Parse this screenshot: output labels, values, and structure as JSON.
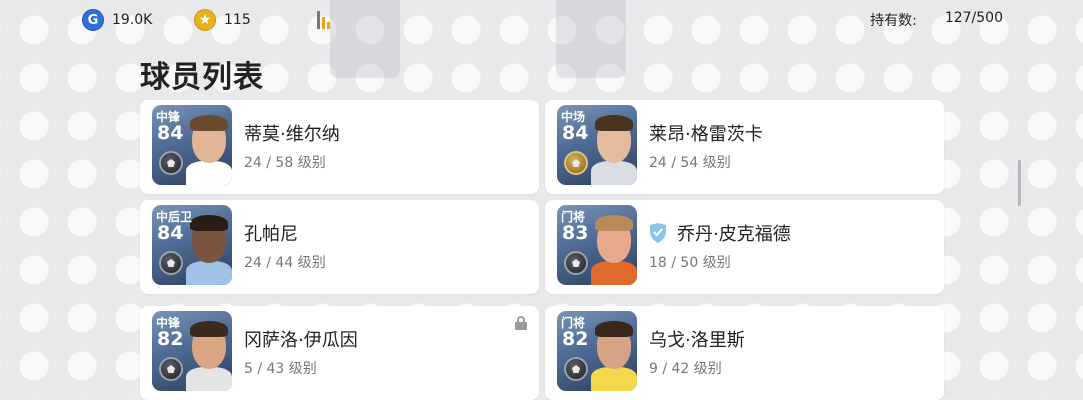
{
  "topbar": {
    "gp": "19.0K",
    "gp_icon": "G",
    "coins": "115",
    "owned_label": "持有数:",
    "owned_value": "127/500"
  },
  "title": "球员列表",
  "players": [
    {
      "position": "中锋",
      "rating": "84",
      "name": "蒂莫·维尔纳",
      "level": "24 / 58 级别",
      "locked": false,
      "badge": "silver",
      "skin": "#e2b597",
      "hair": "#6a4a2c",
      "kit": "#ffffff"
    },
    {
      "position": "中场",
      "rating": "84",
      "name": "莱昂·格雷茨卡",
      "level": "24 / 54 级别",
      "locked": false,
      "badge": "gold",
      "skin": "#e5bb9e",
      "hair": "#4b3322",
      "kit": "#d9dde3"
    },
    {
      "position": "中后卫",
      "rating": "84",
      "name": "孔帕尼",
      "level": "24 / 44 级别",
      "locked": false,
      "badge": "silver",
      "skin": "#7b5440",
      "hair": "#2a1d16",
      "kit": "#9ec3e6"
    },
    {
      "position": "门将",
      "rating": "83",
      "name": "乔丹·皮克福德",
      "level": "18 / 50 级别",
      "locked": false,
      "badge": "silver",
      "skin": "#e8a98c",
      "hair": "#b88a5a",
      "kit": "#e06a2a",
      "team_badge": true
    },
    {
      "position": "中锋",
      "rating": "82",
      "name": "冈萨洛·伊瓜因",
      "level": "5 / 43 级别",
      "locked": true,
      "badge": "silver",
      "skin": "#d9a683",
      "hair": "#3a2a20",
      "kit": "#e4e4e4"
    },
    {
      "position": "门将",
      "rating": "82",
      "name": "乌戈·洛里斯",
      "level": "9 / 42 级别",
      "locked": false,
      "badge": "silver",
      "skin": "#d6a384",
      "hair": "#3a281d",
      "kit": "#f3d94a"
    }
  ],
  "colors": {
    "accent_blue": "#2e6fd9",
    "coin_gold": "#e8b21c",
    "team_badge": "#8cc3ea"
  }
}
